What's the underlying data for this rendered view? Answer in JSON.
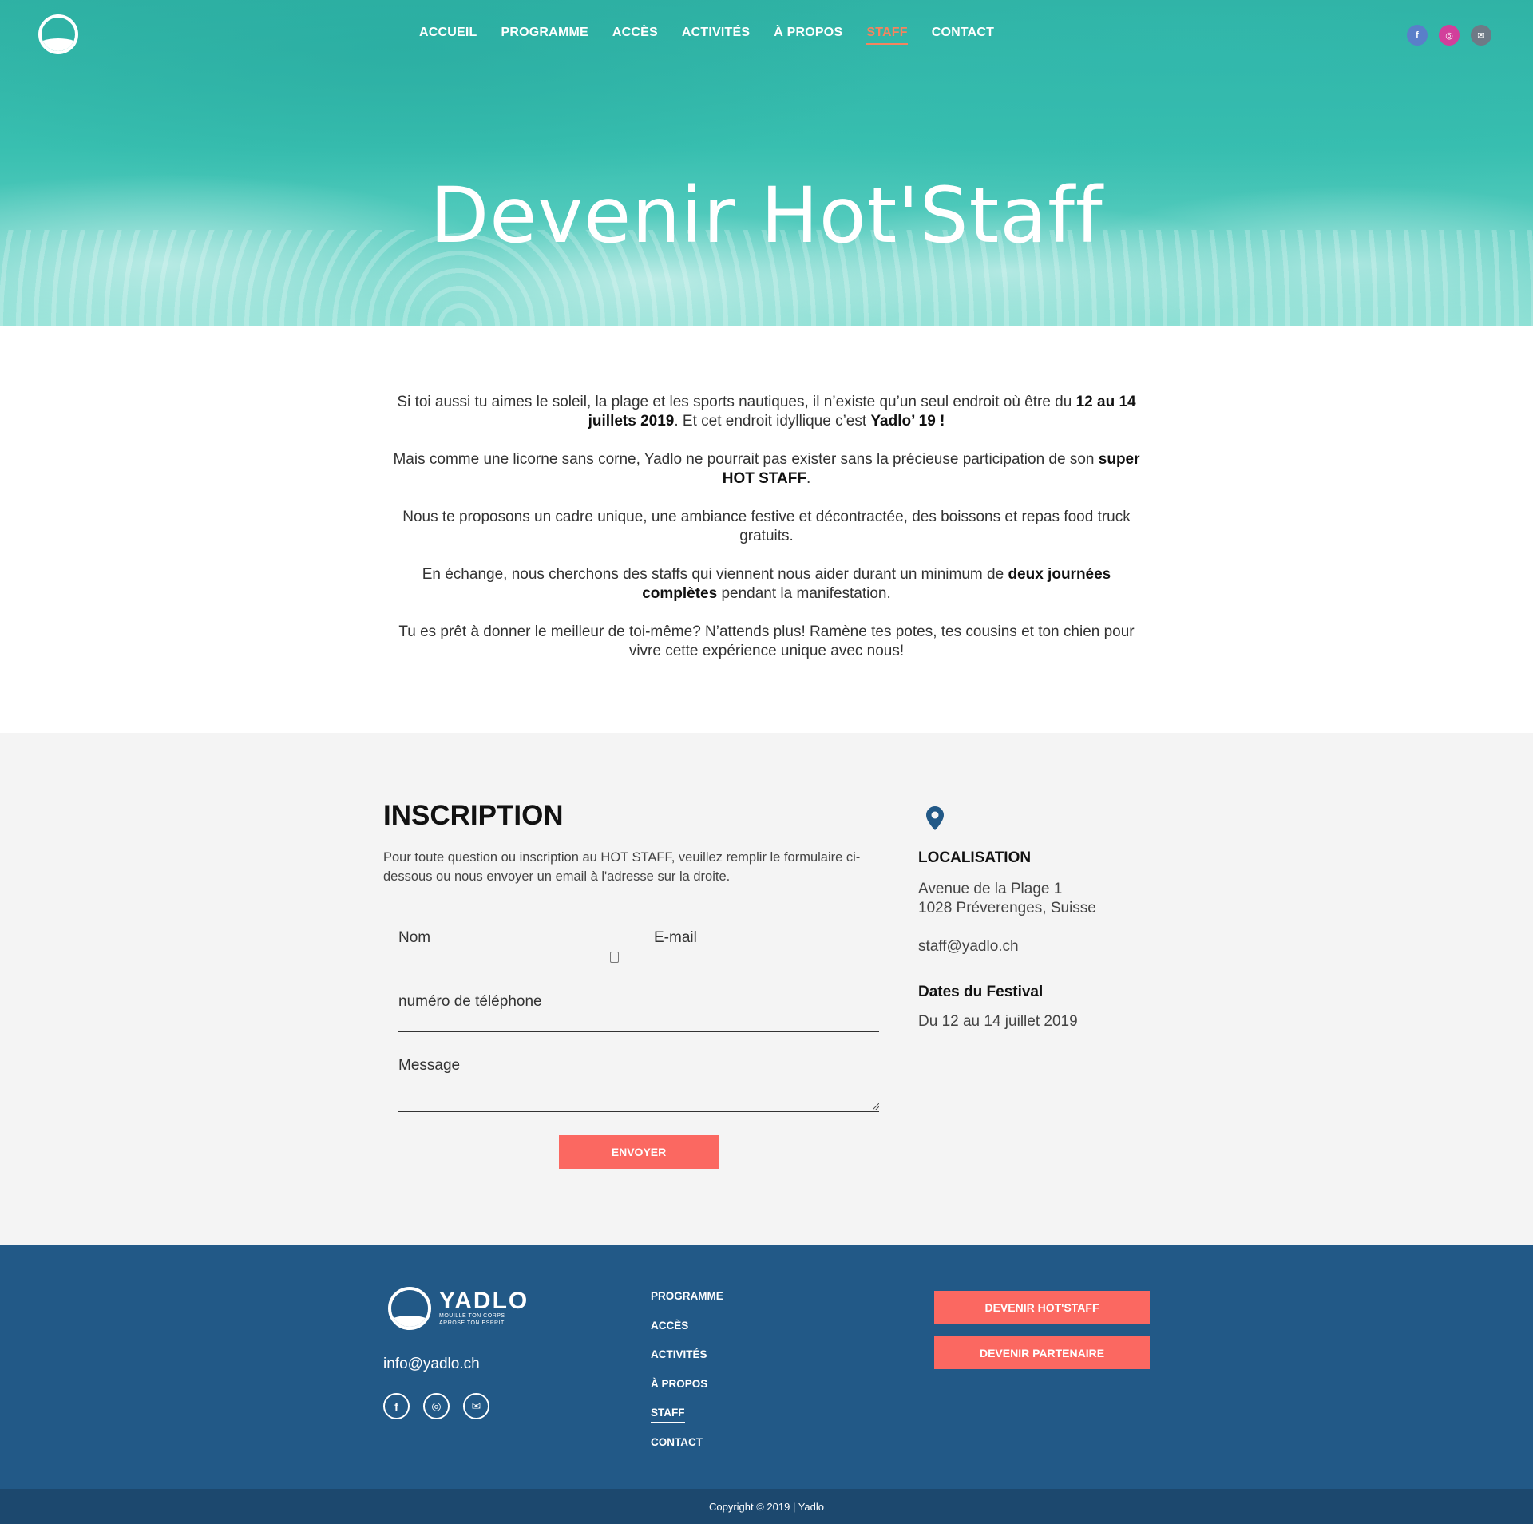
{
  "header": {
    "nav": [
      {
        "label": "ACCUEIL",
        "active": false
      },
      {
        "label": "PROGRAMME",
        "active": false
      },
      {
        "label": "ACCÈS",
        "active": false
      },
      {
        "label": "ACTIVITÉS",
        "active": false
      },
      {
        "label": "À PROPOS",
        "active": false
      },
      {
        "label": "STAFF",
        "active": true
      },
      {
        "label": "CONTACT",
        "active": false
      }
    ],
    "social": {
      "facebook": "f",
      "instagram": "◎",
      "email": "✉"
    },
    "colors": {
      "facebook": "#5a7fc9",
      "instagram": "#d23f9b",
      "email": "#6e7a86",
      "active_nav": "#f5845f"
    }
  },
  "hero": {
    "title": "Devenir Hot'Staff"
  },
  "intro": {
    "p1": {
      "a": "Si toi aussi tu aimes le soleil, la plage et les sports nautiques, il n’existe qu’un seul endroit où être du ",
      "b1": "12 au 14 juillets 2019",
      "c": ". Et cet endroit idyllique c’est ",
      "b2": "Yadlo’ 19 !"
    },
    "p2": {
      "a": "Mais comme une licorne sans corne, Yadlo ne pourrait pas exister sans la précieuse participation de son ",
      "b": "super HOT STAFF",
      "c": "."
    },
    "p3": "Nous te proposons un cadre unique, une ambiance festive et décontractée, des boissons et repas food truck gratuits.",
    "p4": {
      "a": "En échange, nous cherchons des staffs qui viennent nous aider durant un minimum de ",
      "b": "deux journées complètes",
      "c": " pendant la manifestation."
    },
    "p5": "Tu es prêt à donner le meilleur de toi-même? N’attends plus! Ramène tes potes, tes cousins et ton chien pour vivre cette expérience unique avec nous!"
  },
  "inscription": {
    "title": "INSCRIPTION",
    "description": "Pour toute question ou inscription au HOT STAFF, veuillez remplir le formulaire ci-dessous ou nous envoyer un email à l'adresse sur la droite.",
    "fields": {
      "name": "Nom",
      "email": "E-mail",
      "phone": "numéro de téléphone",
      "message": "Message"
    },
    "submit": "ENVOYER"
  },
  "info": {
    "localisation_title": "LOCALISATION",
    "address_line1": "Avenue de la Plage 1",
    "address_line2": "1028 Préverenges, Suisse",
    "email": "staff@yadlo.ch",
    "dates_title": "Dates du Festival",
    "dates": "Du 12 au 14 juillet 2019",
    "icon_color": "#225987"
  },
  "footer": {
    "brand": "YADLO",
    "tagline1": "MOUILLE TON CORPS",
    "tagline2": "ARROSE TON ESPRIT",
    "email": "info@yadlo.ch",
    "links": [
      {
        "label": "PROGRAMME",
        "active": false
      },
      {
        "label": "ACCÈS",
        "active": false
      },
      {
        "label": "ACTIVITÉS",
        "active": false
      },
      {
        "label": "À PROPOS",
        "active": false
      },
      {
        "label": "STAFF",
        "active": true
      },
      {
        "label": "CONTACT",
        "active": false
      }
    ],
    "cta1": "DEVENIR HOT'STAFF",
    "cta2": "DEVENIR PARTENAIRE",
    "copyright": "Copyright © 2019 | Yadlo",
    "colors": {
      "background": "#225987",
      "cta": "#fb6861"
    }
  }
}
